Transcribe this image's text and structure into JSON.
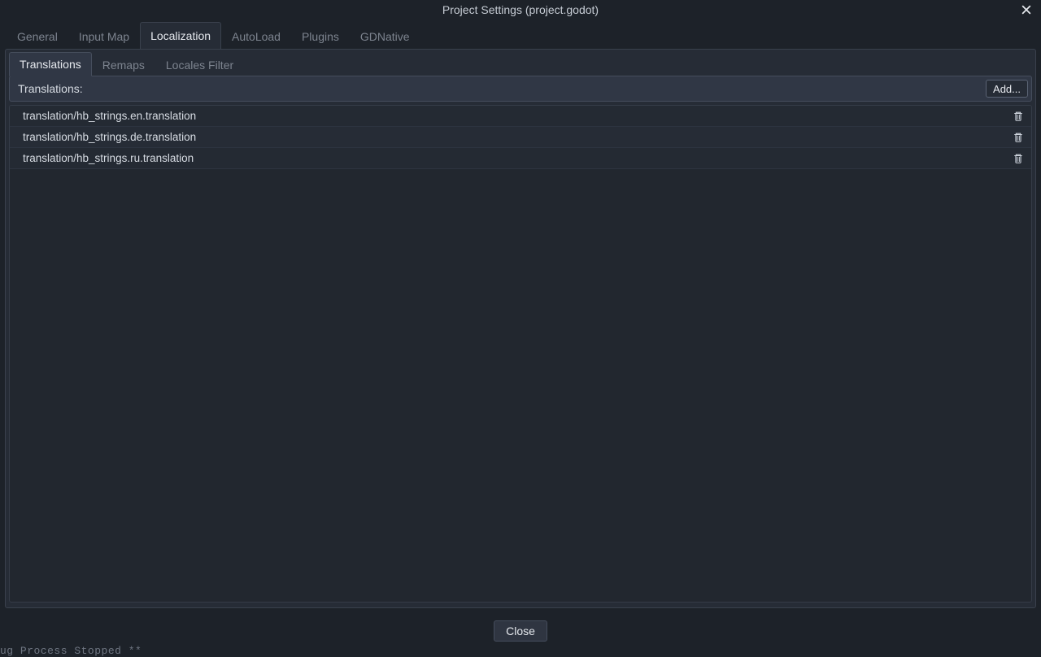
{
  "window": {
    "title": "Project Settings (project.godot)"
  },
  "main_tabs": {
    "items": [
      {
        "label": "General",
        "active": false
      },
      {
        "label": "Input Map",
        "active": false
      },
      {
        "label": "Localization",
        "active": true
      },
      {
        "label": "AutoLoad",
        "active": false
      },
      {
        "label": "Plugins",
        "active": false
      },
      {
        "label": "GDNative",
        "active": false
      }
    ]
  },
  "sub_tabs": {
    "items": [
      {
        "label": "Translations",
        "active": true
      },
      {
        "label": "Remaps",
        "active": false
      },
      {
        "label": "Locales Filter",
        "active": false
      }
    ]
  },
  "header": {
    "label": "Translations:",
    "add_button": "Add..."
  },
  "translations": [
    {
      "path": "translation/hb_strings.en.translation"
    },
    {
      "path": "translation/hb_strings.de.translation"
    },
    {
      "path": "translation/hb_strings.ru.translation"
    }
  ],
  "footer": {
    "close_button": "Close"
  },
  "status": {
    "text": "ug Process Stopped **"
  }
}
